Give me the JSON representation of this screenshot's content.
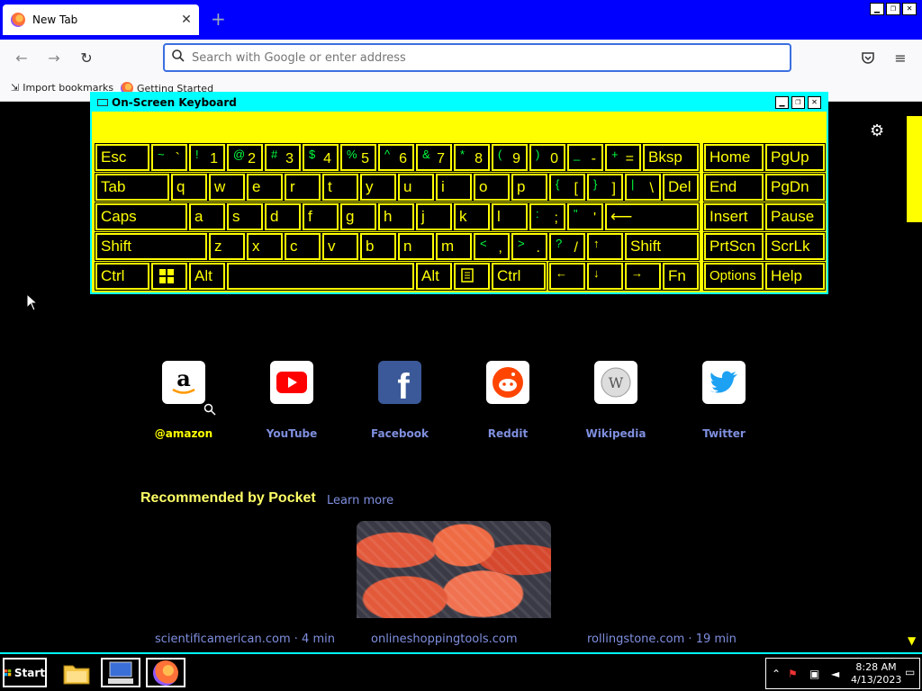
{
  "browser": {
    "tab_title": "New Tab",
    "tab_close": "✕",
    "new_tab": "+",
    "window_buttons": [
      "▁",
      "❐",
      "✕"
    ],
    "url_placeholder": "Search with Google or enter address",
    "bookmarks": [
      {
        "label": "Import bookmarks",
        "icon": "import-icon"
      },
      {
        "label": "Getting Started",
        "icon": "firefox-icon"
      }
    ]
  },
  "osk": {
    "title": "On-Screen Keyboard",
    "window_buttons": [
      "▁",
      "❐",
      "✕"
    ],
    "keys": {
      "esc": "Esc",
      "tilde": "~",
      "grave": "`",
      "excl": "!",
      "one": "1",
      "at": "@",
      "two": "2",
      "hash": "#",
      "three": "3",
      "dollar": "$",
      "four": "4",
      "pct": "%",
      "five": "5",
      "caret": "^",
      "six": "6",
      "amp": "&",
      "seven": "7",
      "star": "*",
      "eight": "8",
      "lparen": "(",
      "nine": "9",
      "rparen": ")",
      "zero": "0",
      "under": "_",
      "minus": "-",
      "plus": "+",
      "equals": "=",
      "bksp": "Bksp",
      "home": "Home",
      "pgup": "PgUp",
      "tab": "Tab",
      "q": "q",
      "w": "w",
      "e": "e",
      "r": "r",
      "t": "t",
      "y": "y",
      "u": "u",
      "i": "i",
      "o": "o",
      "p": "p",
      "lbrace": "{",
      "lbrack": "[",
      "rbrace": "}",
      "rbrack": "]",
      "pipe": "|",
      "bslash": "\\",
      "del": "Del",
      "end": "End",
      "pgdn": "PgDn",
      "caps": "Caps",
      "a": "a",
      "s": "s",
      "d": "d",
      "f": "f",
      "g": "g",
      "h": "h",
      "j": "j",
      "k": "k",
      "l": "l",
      "colon": ":",
      "semi": ";",
      "dquote": "\"",
      "squote": "'",
      "enter": "⟵",
      "insert": "Insert",
      "pause": "Pause",
      "shift": "Shift",
      "z": "z",
      "x": "x",
      "c": "c",
      "v": "v",
      "b": "b",
      "n": "n",
      "m": "m",
      "lt": "<",
      "comma": ",",
      "gt": ">",
      "period": ".",
      "qmark": "?",
      "slash": "/",
      "up": "↑",
      "shift_r": "Shift",
      "prtscn": "PrtScn",
      "scrlk": "ScrLk",
      "ctrl": "Ctrl",
      "alt": "Alt",
      "alt_r": "Alt",
      "ctrl_r": "Ctrl",
      "left": "←",
      "down": "↓",
      "right": "→",
      "fn": "Fn",
      "options": "Options",
      "help": "Help"
    }
  },
  "newtab": {
    "shortcuts": [
      {
        "label": "@amazon",
        "icon": "amazon-icon"
      },
      {
        "label": "YouTube",
        "icon": "youtube-icon"
      },
      {
        "label": "Facebook",
        "icon": "facebook-icon"
      },
      {
        "label": "Reddit",
        "icon": "reddit-icon"
      },
      {
        "label": "Wikipedia",
        "icon": "wikipedia-icon"
      },
      {
        "label": "Twitter",
        "icon": "twitter-icon"
      }
    ],
    "pocket_title": "Recommended by Pocket",
    "pocket_link": "Learn more",
    "sources": [
      "scientificamerican.com · 4 min",
      "onlineshoppingtools.com",
      "rollingstone.com · 19 min"
    ]
  },
  "taskbar": {
    "start": "Start",
    "time": "8:28 AM",
    "date": "4/13/2023"
  },
  "colors": {
    "osk_bg": "#ffff00",
    "osk_border": "#00ffff",
    "tabbar": "#0000ff",
    "link": "#7f8fdf"
  }
}
